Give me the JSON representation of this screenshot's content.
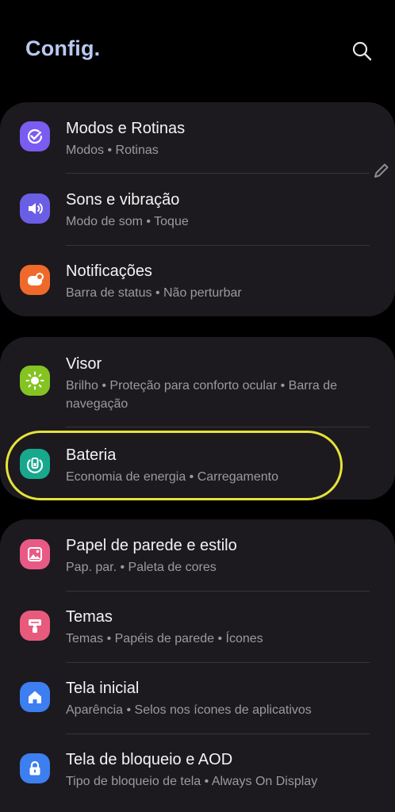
{
  "header": {
    "title": "Config.",
    "search_icon": "search-icon"
  },
  "groups": [
    {
      "items": [
        {
          "title": "Modos e Rotinas",
          "subtitle": "Modos  •  Rotinas",
          "icon": "modes-check-icon",
          "icon_color": "#7a5cf0"
        },
        {
          "title": "Sons e vibração",
          "subtitle": "Modo de som  •  Toque",
          "icon": "speaker-icon",
          "icon_color": "#6b5ee6"
        },
        {
          "title": "Notificações",
          "subtitle": "Barra de status  •  Não perturbar",
          "icon": "notification-icon",
          "icon_color": "#ef6a2a"
        }
      ]
    },
    {
      "items": [
        {
          "title": "Visor",
          "subtitle": "Brilho  •  Proteção para conforto ocular  •  Barra de navegação",
          "icon": "brightness-icon",
          "icon_color": "#84c322"
        },
        {
          "title": "Bateria",
          "subtitle": "Economia de energia  •  Carregamento",
          "icon": "battery-icon",
          "icon_color": "#18a88e"
        }
      ]
    },
    {
      "items": [
        {
          "title": "Papel de parede e estilo",
          "subtitle": "Pap. par.  •  Paleta de cores",
          "icon": "wallpaper-icon",
          "icon_color": "#e85a86"
        },
        {
          "title": "Temas",
          "subtitle": "Temas  •  Papéis de parede  •  Ícones",
          "icon": "themes-icon",
          "icon_color": "#e85a7c"
        },
        {
          "title": "Tela inicial",
          "subtitle": "Aparência  •  Selos nos ícones de aplicativos",
          "icon": "home-icon",
          "icon_color": "#3d7ef0"
        },
        {
          "title": "Tela de bloqueio e AOD",
          "subtitle": "Tipo de bloqueio de tela  •  Always On Display",
          "icon": "lock-icon",
          "icon_color": "#3d7ef0"
        }
      ]
    }
  ],
  "edit_icon": "pencil-icon",
  "highlight_color": "#e6e23a"
}
